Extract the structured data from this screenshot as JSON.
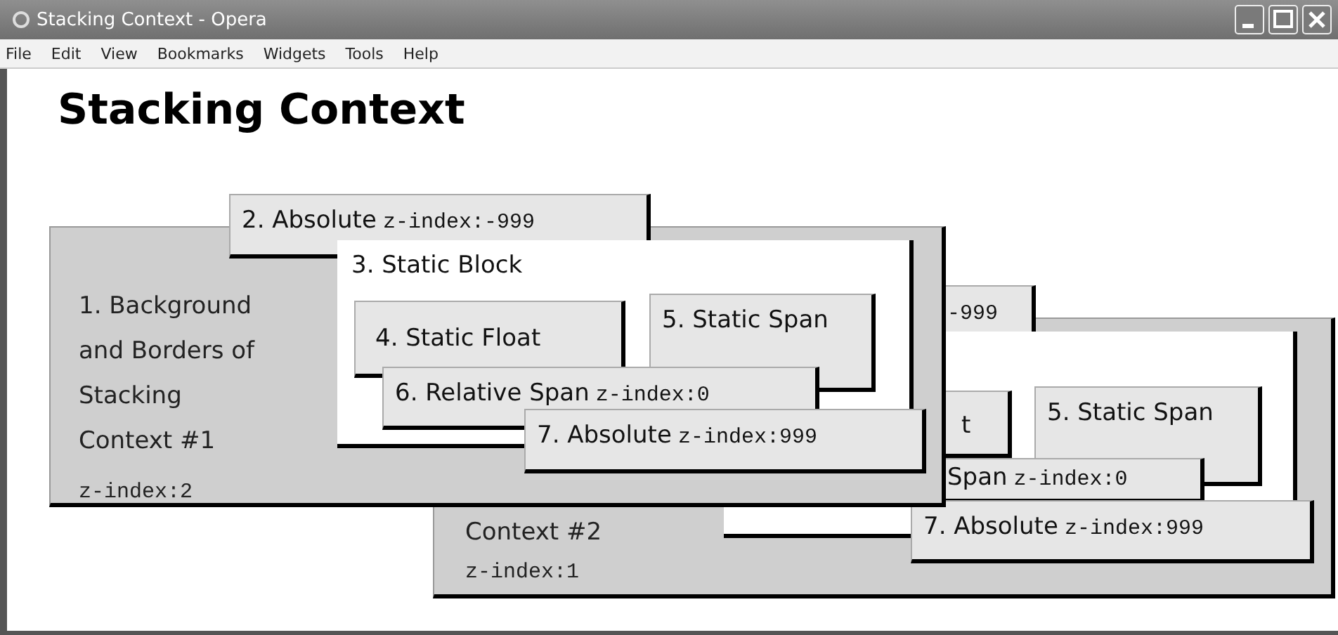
{
  "window": {
    "title": "Stacking Context - Opera"
  },
  "menu": [
    "File",
    "Edit",
    "View",
    "Bookmarks",
    "Widgets",
    "Tools",
    "Help"
  ],
  "page": {
    "heading": "Stacking Context",
    "contexts": [
      {
        "label": "1. Background and Borders of Stacking Context #1",
        "z_index": "z-index:2",
        "boxes": [
          {
            "kind": "absolute",
            "text": "2. Absolute",
            "code": "z-index:-999"
          },
          {
            "kind": "block",
            "text": "3. Static Block"
          },
          {
            "kind": "float",
            "text": "4. Static Float"
          },
          {
            "kind": "span",
            "text": "5. Static Span"
          },
          {
            "kind": "relative",
            "text": "6. Relative Span",
            "code": "z-index:0"
          },
          {
            "kind": "absolute",
            "text": "7. Absolute",
            "code": "z-index:999"
          }
        ]
      },
      {
        "label": "Context #2",
        "z_index": "z-index:1",
        "boxes": [
          {
            "kind": "absolute",
            "code": "-999"
          },
          {
            "kind": "block"
          },
          {
            "kind": "float",
            "text": "t"
          },
          {
            "kind": "span",
            "text": "5. Static Span"
          },
          {
            "kind": "relative",
            "text": "Span",
            "code": "z-index:0"
          },
          {
            "kind": "absolute",
            "text": "7. Absolute",
            "code": "z-index:999"
          }
        ]
      }
    ]
  }
}
